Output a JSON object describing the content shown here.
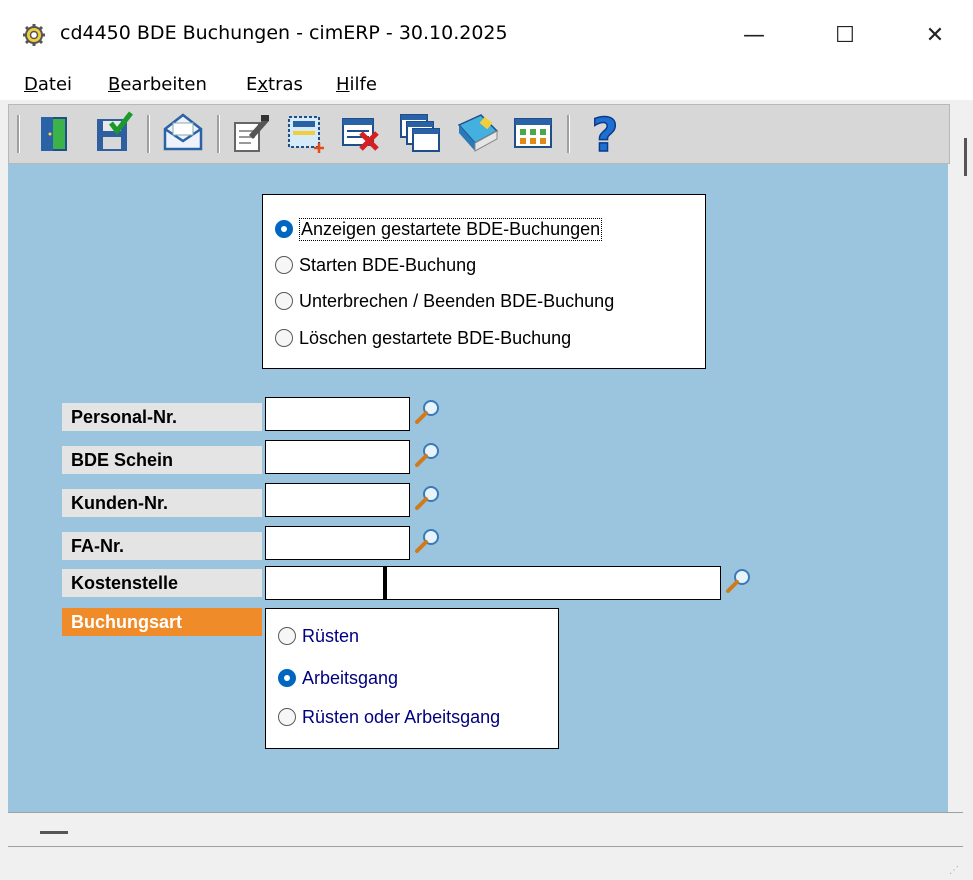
{
  "window": {
    "title": "cd4450 BDE Buchungen - cimERP - 30.10.2025",
    "minimize": "—",
    "maximize": "☐",
    "close": "✕"
  },
  "menu": {
    "items": [
      {
        "label": "Datei",
        "accel": "D",
        "rest": "atei"
      },
      {
        "label": "Bearbeiten",
        "accel": "B",
        "rest": "earbeiten"
      },
      {
        "label": "Extras",
        "pre": "E",
        "accel": "x",
        "rest": "tras"
      },
      {
        "label": "Hilfe",
        "accel": "H",
        "rest": "ilfe"
      }
    ]
  },
  "toolbar": {
    "buttons": [
      "exit-icon",
      "save-icon",
      "mail-icon",
      "edit-icon",
      "new-record-icon",
      "delete-icon",
      "windows-icon",
      "book-icon",
      "grid-icon",
      "help-icon"
    ]
  },
  "mode_group": {
    "options": [
      {
        "label": "Anzeigen gestartete BDE-Buchungen",
        "checked": true
      },
      {
        "label": "Starten BDE-Buchung",
        "checked": false
      },
      {
        "label": "Unterbrechen / Beenden BDE-Buchung",
        "checked": false
      },
      {
        "label": "Löschen gestartete BDE-Buchung",
        "checked": false
      }
    ]
  },
  "fields": {
    "personal_nr": {
      "label": "Personal-Nr.",
      "value": ""
    },
    "bde_schein": {
      "label": "BDE Schein",
      "value": ""
    },
    "kunden_nr": {
      "label": "Kunden-Nr.",
      "value": ""
    },
    "fa_nr": {
      "label": "FA-Nr.",
      "value": ""
    },
    "kostenstelle": {
      "label": "Kostenstelle",
      "value1": "",
      "value2": ""
    },
    "buchungsart": {
      "label": "Buchungsart"
    }
  },
  "buchungsart_group": {
    "options": [
      {
        "label": "Rüsten",
        "checked": false
      },
      {
        "label": "Arbeitsgang",
        "checked": true
      },
      {
        "label": "Rüsten oder Arbeitsgang",
        "checked": false
      }
    ]
  },
  "colors": {
    "content_bg": "#9bc4de",
    "accent_label": "#f08b2a",
    "radio_checked": "#0067c0"
  }
}
